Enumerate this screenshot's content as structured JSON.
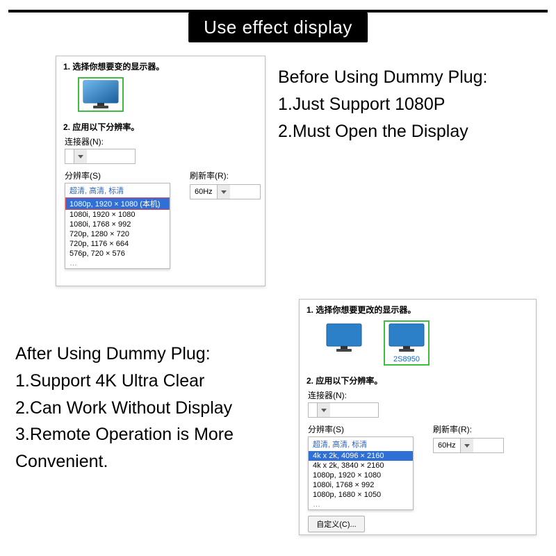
{
  "header": {
    "title": "Use effect display"
  },
  "labels": {
    "adapter": "连接器(N):",
    "resolution": "分辨率(S)",
    "refresh": "刷新率(R):",
    "custom_btn": "自定义(C)..."
  },
  "copy": {
    "before": {
      "title": "Before Using Dummy Plug:",
      "line1": "1.Just Support 1080P",
      "line2": "2.Must Open the Display"
    },
    "after": {
      "title": "After Using Dummy Plug:",
      "line1": "1.Support 4K Ultra Clear",
      "line2": "2.Can Work Without Display",
      "line3": "3.Remote Operation is More Convenient."
    }
  },
  "panels": {
    "before": {
      "step1": "1.  选择你想要变的显示器。",
      "step2": "2.  应用以下分辨率。",
      "group_header": "超清, 高清, 标清",
      "refresh": "60Hz",
      "resolutions": [
        "1080p, 1920 × 1080 (本机)",
        "1080i, 1920 × 1080",
        "1080i, 1768 × 992",
        "720p, 1280 × 720",
        "720p, 1176 × 664",
        "576p, 720 × 576",
        "…"
      ]
    },
    "after": {
      "step1": "1.  选择你想要更改的显示器。",
      "step2": "2.  应用以下分辨率。",
      "display2_caption": "2S8950",
      "group_header": "超清, 高清, 标清",
      "refresh": "60Hz",
      "resolutions": [
        "4k x 2k, 4096 × 2160",
        "4k x 2k, 3840 × 2160",
        "1080p, 1920 × 1080",
        "1080i, 1768 × 992",
        "1080p, 1680 × 1050",
        "…"
      ]
    }
  }
}
